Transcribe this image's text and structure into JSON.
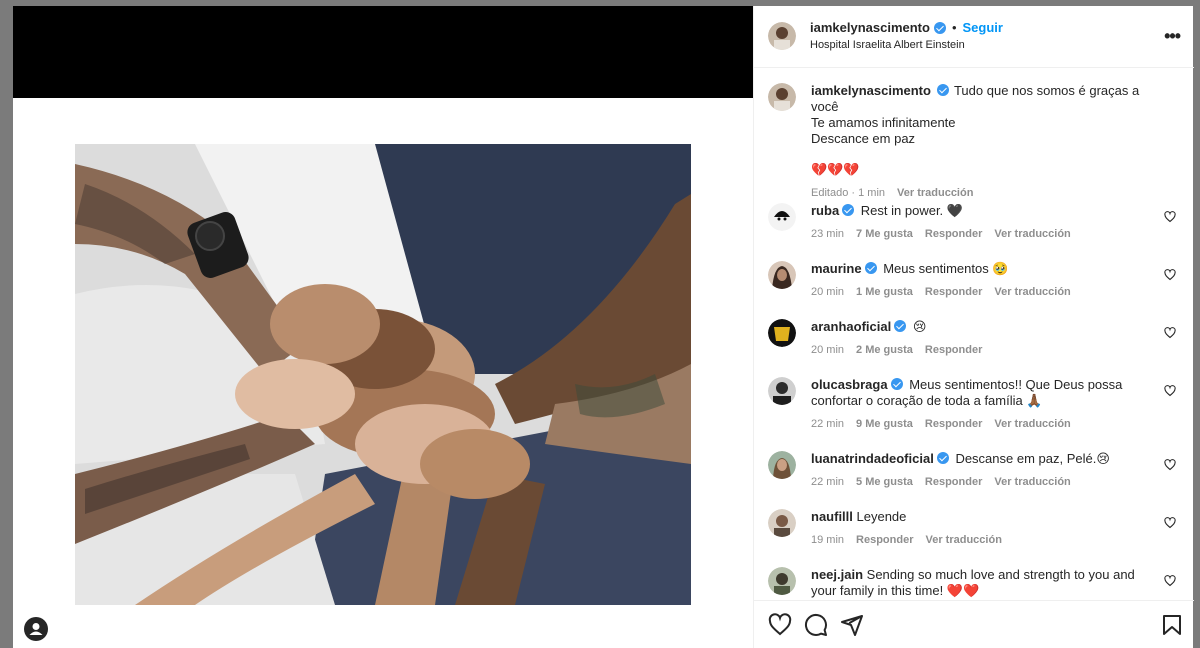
{
  "post": {
    "author": "iamkelynascimento",
    "follow_label": "Seguir",
    "separator": "•",
    "location": "Hospital Israelita Albert Einstein",
    "more_label": "•••"
  },
  "caption": {
    "user": "iamkelynascimento",
    "line1": "Tudo que nos somos é graças a você",
    "line2": "Te amamos infinitamente",
    "line3": "Descance em paz",
    "hearts": "💔💔💔",
    "edited": "Editado",
    "time": "1 min",
    "translate": "Ver traducción",
    "dot": "·"
  },
  "comments": [
    {
      "user": "ruba",
      "verified": true,
      "text": "Rest in power. 🖤",
      "time": "23 min",
      "likes": "7 Me gusta",
      "reply": "Responder",
      "translate": "Ver traducción",
      "avatar_color": "#f3f3f3"
    },
    {
      "user": "maurine",
      "verified": true,
      "text": "Meus sentimentos 🥹",
      "time": "20 min",
      "likes": "1 Me gusta",
      "reply": "Responder",
      "translate": "Ver traducción",
      "avatar_color": "#5a3d33"
    },
    {
      "user": "aranhaoficial",
      "verified": true,
      "text": "😢",
      "time": "20 min",
      "likes": "2 Me gusta",
      "reply": "Responder",
      "translate": "",
      "avatar_color": "#c9a21a"
    },
    {
      "user": "olucasbraga",
      "verified": true,
      "text": "Meus sentimentos!! Que Deus possa confortar o coração de toda a família 🙏🏾",
      "time": "22 min",
      "likes": "9 Me gusta",
      "reply": "Responder",
      "translate": "Ver traducción",
      "avatar_color": "#3b3b3b"
    },
    {
      "user": "luanatrindadeoficial",
      "verified": true,
      "text": "Descanse em paz, Pelé.😢",
      "time": "22 min",
      "likes": "5 Me gusta",
      "reply": "Responder",
      "translate": "Ver traducción",
      "avatar_color": "#8a7a6a"
    },
    {
      "user": "naufilll",
      "verified": false,
      "text": "Leyende",
      "time": "19 min",
      "likes": "",
      "reply": "Responder",
      "translate": "Ver traducción",
      "avatar_color": "#6b5b4b"
    },
    {
      "user": "neej.jain",
      "verified": false,
      "text": "Sending so much love and strength to you and your family in this time! ❤️❤️",
      "time": "",
      "likes": "",
      "reply": "",
      "translate": "",
      "avatar_color": "#55604a"
    }
  ],
  "colors": {
    "accent": "#0095f6",
    "verified": "#3897f0",
    "muted_text": "#8e8e8e",
    "backdrop": "#7b7b7b"
  },
  "icons": {
    "like": "heart-icon",
    "comment": "comment-icon",
    "share": "send-icon",
    "save": "bookmark-icon",
    "more": "more-icon"
  }
}
